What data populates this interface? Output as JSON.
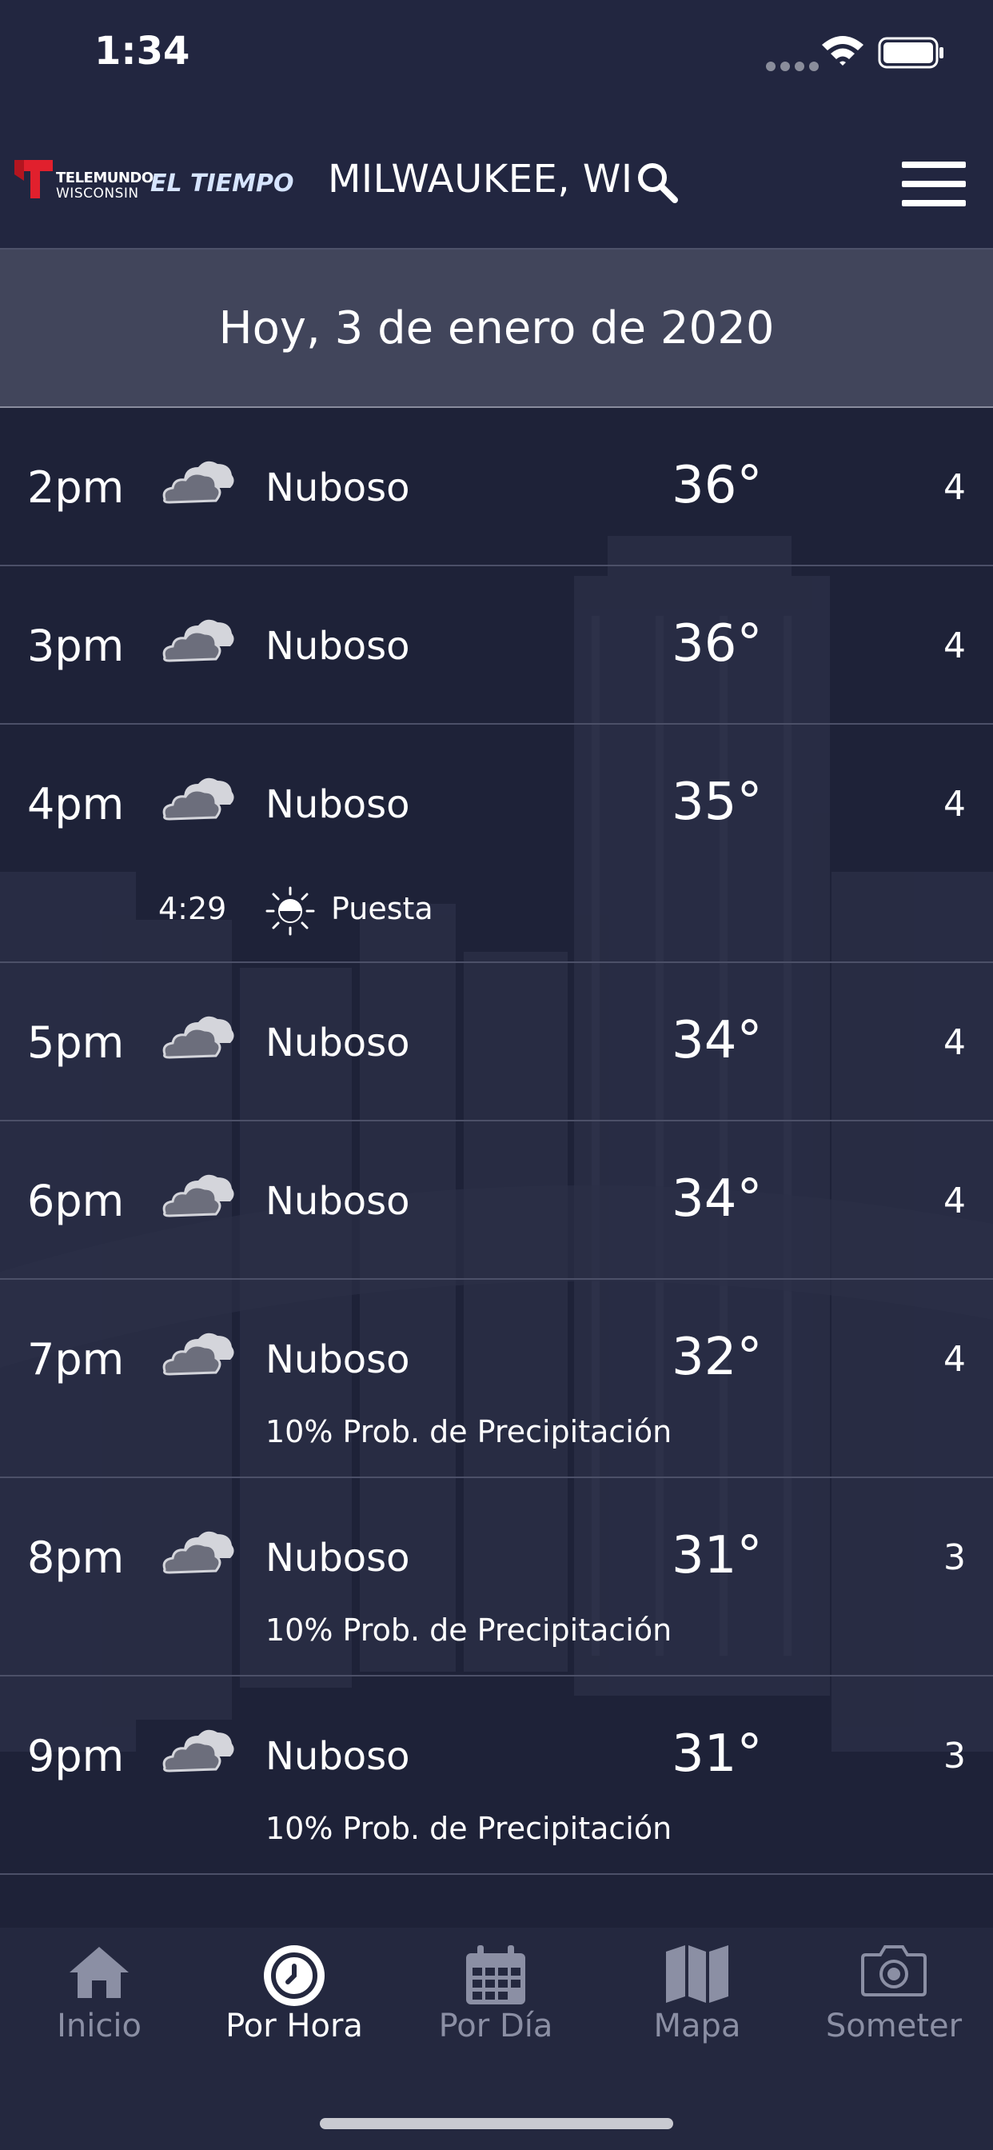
{
  "status_bar": {
    "time": "1:34"
  },
  "header": {
    "logo_sub1": "TELEMUNDO",
    "logo_sub2": "WISCONSIN",
    "logo_brand": "EL TIEMPO",
    "location": "MILWAUKEE, WI"
  },
  "date_label": "Hoy, 3 de enero de 2020",
  "hours": [
    {
      "time": "2pm",
      "condition": "Nuboso",
      "temp": "36°",
      "wind": "4",
      "icon": "cloudy-icon"
    },
    {
      "time": "3pm",
      "condition": "Nuboso",
      "temp": "36°",
      "wind": "4",
      "icon": "cloudy-icon"
    },
    {
      "time": "4pm",
      "condition": "Nuboso",
      "temp": "35°",
      "wind": "4",
      "icon": "cloudy-icon"
    },
    {
      "time": "5pm",
      "condition": "Nuboso",
      "temp": "34°",
      "wind": "4",
      "icon": "cloudy-icon"
    },
    {
      "time": "6pm",
      "condition": "Nuboso",
      "temp": "34°",
      "wind": "4",
      "icon": "cloudy-icon"
    },
    {
      "time": "7pm",
      "condition": "Nuboso",
      "temp": "32°",
      "wind": "4",
      "icon": "cloudy-icon",
      "precip": "10% Prob. de Precipitación"
    },
    {
      "time": "8pm",
      "condition": "Nuboso",
      "temp": "31°",
      "wind": "3",
      "icon": "cloudy-icon",
      "precip": "10% Prob. de Precipitación"
    },
    {
      "time": "9pm",
      "condition": "Nuboso",
      "temp": "31°",
      "wind": "3",
      "icon": "cloudy-icon",
      "precip": "10% Prob. de Precipitación"
    }
  ],
  "sunset": {
    "time": "4:29",
    "label": "Puesta",
    "icon": "sunset-icon"
  },
  "tabs": [
    {
      "label": "Inicio",
      "icon": "home-icon"
    },
    {
      "label": "Por Hora",
      "icon": "clock-icon",
      "active": true
    },
    {
      "label": "Por Día",
      "icon": "calendar-icon"
    },
    {
      "label": "Mapa",
      "icon": "map-icon"
    },
    {
      "label": "Someter",
      "icon": "camera-icon"
    }
  ],
  "colors": {
    "background": "#1e2238",
    "header": "#222640",
    "date_bar": "#41455b",
    "logo_red": "#e1202d",
    "tab_inactive": "#8b8fa4",
    "tab_active": "#ffffff"
  }
}
